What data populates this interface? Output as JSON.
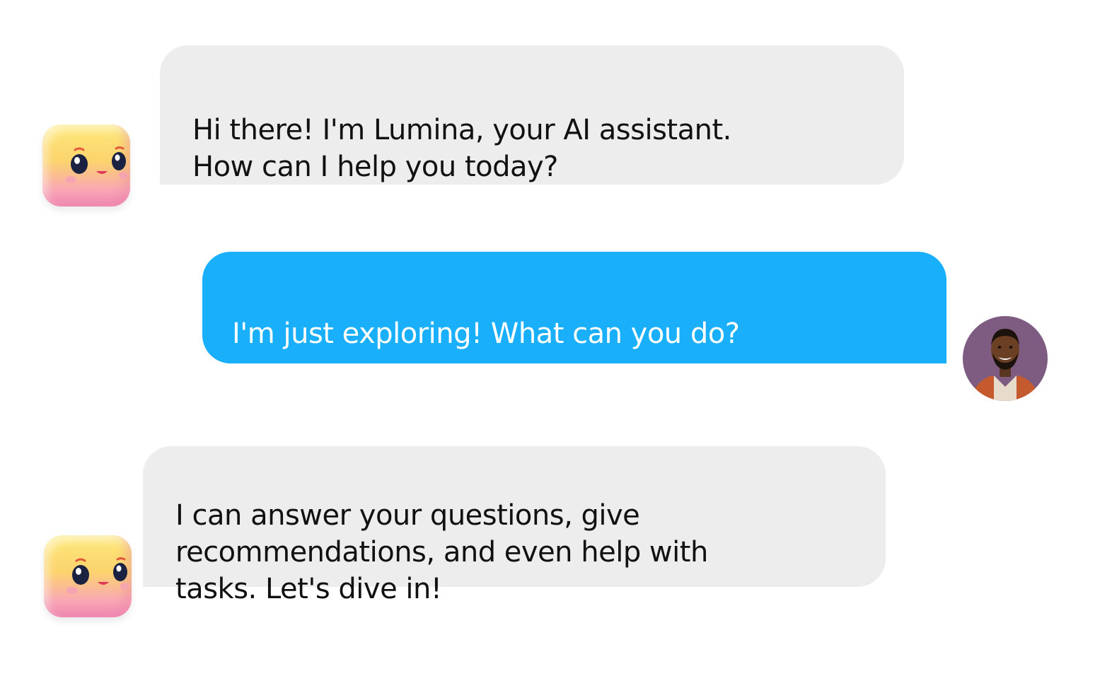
{
  "colors": {
    "bot_bubble": "#ededed",
    "user_bubble": "#1aaffb",
    "user_avatar_bg": "#7e5c82"
  },
  "messages": [
    {
      "sender": "assistant",
      "text": "Hi there! I'm Lumina, your AI assistant.\nHow can I help you today?",
      "avatar_icon": "marshmallow-bot-icon"
    },
    {
      "sender": "user",
      "text": "I'm just exploring! What can you do?",
      "avatar_icon": "user-photo-avatar"
    },
    {
      "sender": "assistant",
      "text": "I can answer your questions, give\nrecommendations, and even help with\ntasks. Let's dive in!",
      "avatar_icon": "marshmallow-bot-icon"
    }
  ]
}
